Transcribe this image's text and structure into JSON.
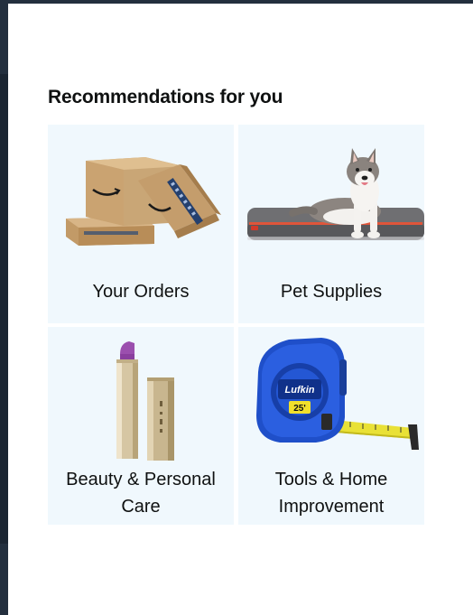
{
  "section": {
    "title": "Recommendations for you"
  },
  "tiles": [
    {
      "label": "Your Orders",
      "icon": "amazon-boxes-icon"
    },
    {
      "label": "Pet Supplies",
      "icon": "dog-on-bed-icon"
    },
    {
      "label": "Beauty & Personal Care",
      "icon": "lipstick-icon"
    },
    {
      "label": "Tools & Home Improvement",
      "icon": "tape-measure-icon"
    }
  ],
  "product_marks": {
    "tape_brand": "Lufkin",
    "tape_size": "25'"
  },
  "colors": {
    "frame": "#232f3e",
    "tile_background": "#f0f8fd",
    "text": "#0f1111",
    "box_cardboard": "#c9a676",
    "tape_blue": "#1f4fc9",
    "lipstick_purple": "#9b4fae"
  }
}
